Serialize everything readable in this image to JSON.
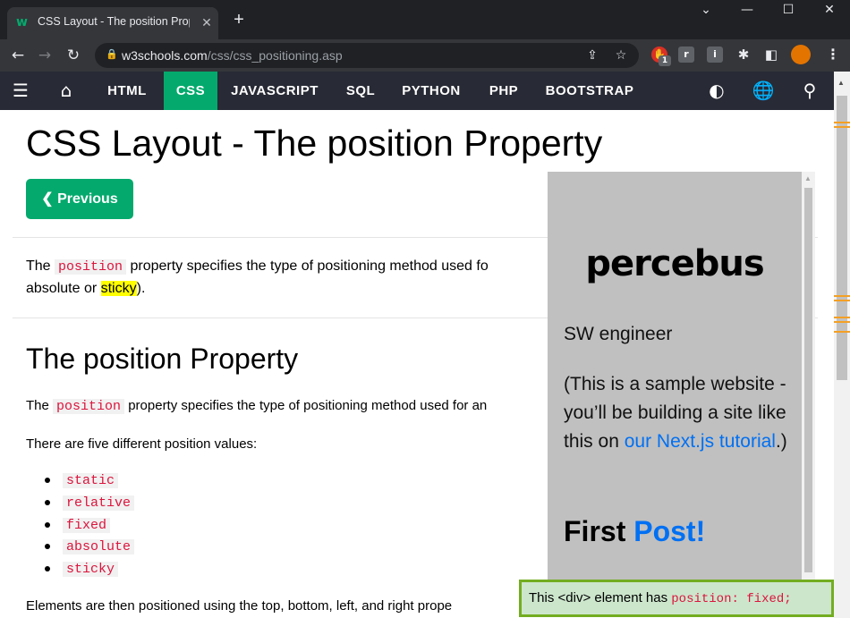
{
  "browser": {
    "tab_title": "CSS Layout - The position Proper",
    "tab_favicon": "w3schools-logo-icon",
    "new_tab": "+",
    "url_host": "w3schools.com",
    "url_path": "/css/css_positioning.asp",
    "extension_badge": "1",
    "ext_r": "r",
    "ext_i": "i"
  },
  "w3nav": {
    "items": [
      "HTML",
      "CSS",
      "JAVASCRIPT",
      "SQL",
      "PYTHON",
      "PHP",
      "BOOTSTRAP"
    ],
    "active": "CSS"
  },
  "page": {
    "title": "CSS Layout - The position Property",
    "prev_button": "❮ Previous",
    "intro_a": "The ",
    "intro_code": "position",
    "intro_b": " property specifies the type of positioning method used fo",
    "intro2_a": "absolute or ",
    "intro2_sticky": "sticky",
    "intro2_b": ").",
    "h2": "The position Property",
    "p1_a": "The ",
    "p1_code": "position",
    "p1_b": " property specifies the type of positioning method used for an",
    "p2": "There are five different position values:",
    "values": [
      "static",
      "relative",
      "fixed",
      "absolute",
      "sticky"
    ],
    "p3": "Elements are then positioned using the top, bottom, left, and right prope"
  },
  "demo": {
    "name": "percebus",
    "role": "SW engineer",
    "desc_a": "(This is a sample website - you’ll be building a site like this on ",
    "desc_link": "our Next.js tutorial",
    "desc_b": ".)",
    "post_a": "First ",
    "post_b": "Post!"
  },
  "fixed_box": {
    "text": "This <div> element has ",
    "code": "position: fixed;"
  },
  "colors": {
    "accent": "#04aa6d",
    "nav_bg": "#282a35",
    "code": "#dc143c",
    "highlight": "#ffff00",
    "link": "#0070f3"
  }
}
